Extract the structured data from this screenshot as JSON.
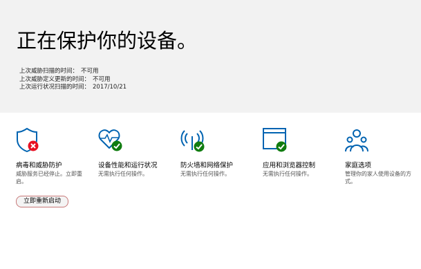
{
  "header": {
    "title": "正在保护你的设备。",
    "info": [
      {
        "label": "上次威胁扫描的时间：",
        "value": "不可用"
      },
      {
        "label": "上次威胁定义更新的时间：",
        "value": "不可用"
      },
      {
        "label": "上次运行状况扫描的时间：",
        "value": "2017/10/21"
      }
    ]
  },
  "tiles": [
    {
      "name": "病毒和威胁防护",
      "desc": "威胁服务已经停止。立即重启。",
      "icon": "shield-icon",
      "status": "error"
    },
    {
      "name": "设备性能和运行状况",
      "desc": "无需执行任何操作。",
      "icon": "heart-pulse-icon",
      "status": "ok"
    },
    {
      "name": "防火墙和网络保护",
      "desc": "无需执行任何操作。",
      "icon": "wireless-signal-icon",
      "status": "ok"
    },
    {
      "name": "应用和浏览器控制",
      "desc": "无需执行任何操作。",
      "icon": "app-window-icon",
      "status": "ok"
    },
    {
      "name": "家庭选项",
      "desc": "管理你的家人使用设备的方式。",
      "icon": "family-icon"
    }
  ],
  "restart_button": {
    "label": "立即重新启动"
  },
  "colors": {
    "accent": "#0063b1",
    "ok": "#107c10",
    "error": "#e81123",
    "header_bg": "#f2f2f2"
  }
}
